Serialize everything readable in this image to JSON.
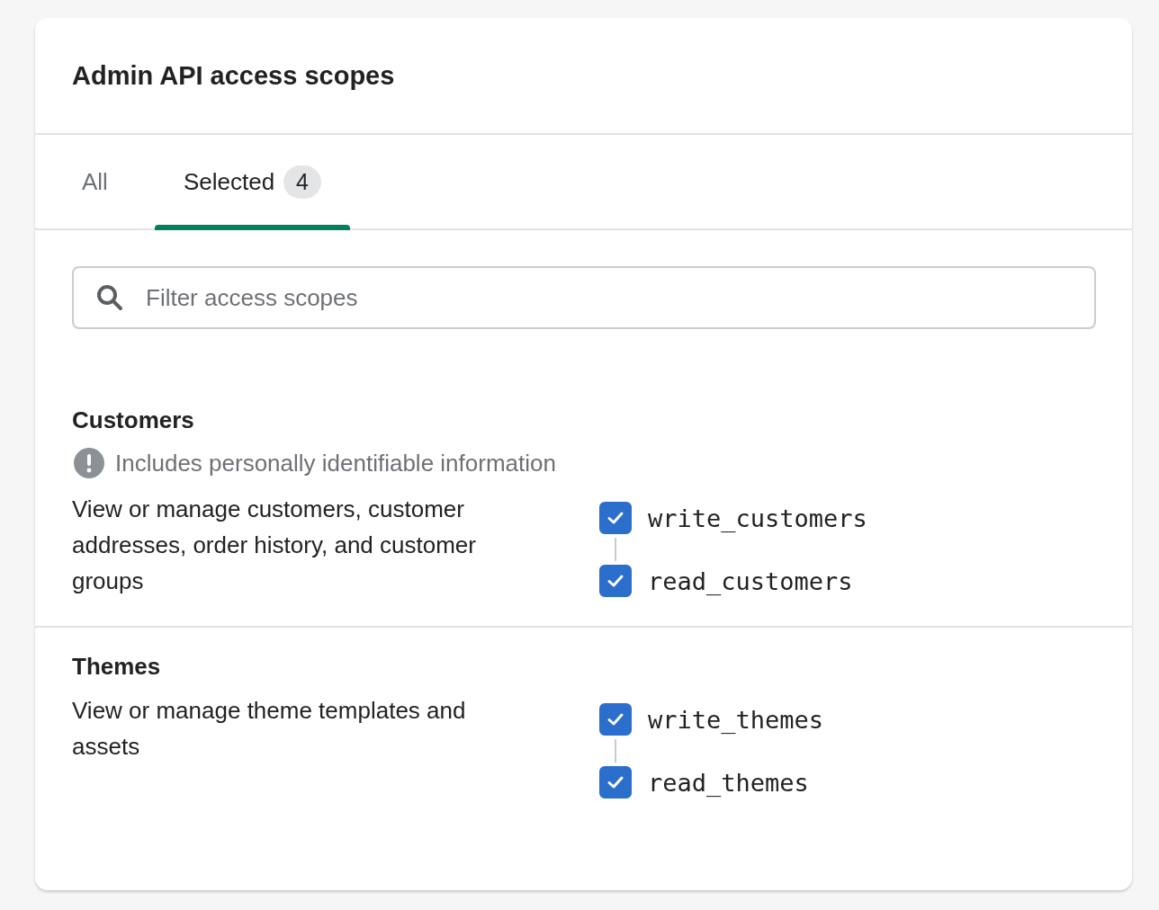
{
  "card": {
    "title": "Admin API access scopes"
  },
  "tabs": [
    {
      "label": "All",
      "selected": false
    },
    {
      "label": "Selected",
      "badge": "4",
      "selected": true
    }
  ],
  "search": {
    "placeholder": "Filter access scopes"
  },
  "sections": [
    {
      "title": "Customers",
      "notice": "Includes personally identifiable information",
      "description": "View or manage customers, customer addresses, order history, and customer groups",
      "scopes": [
        {
          "name": "write_customers",
          "checked": true
        },
        {
          "name": "read_customers",
          "checked": true
        }
      ]
    },
    {
      "title": "Themes",
      "description": "View or manage theme templates and assets",
      "scopes": [
        {
          "name": "write_themes",
          "checked": true
        },
        {
          "name": "read_themes",
          "checked": true
        }
      ]
    }
  ]
}
